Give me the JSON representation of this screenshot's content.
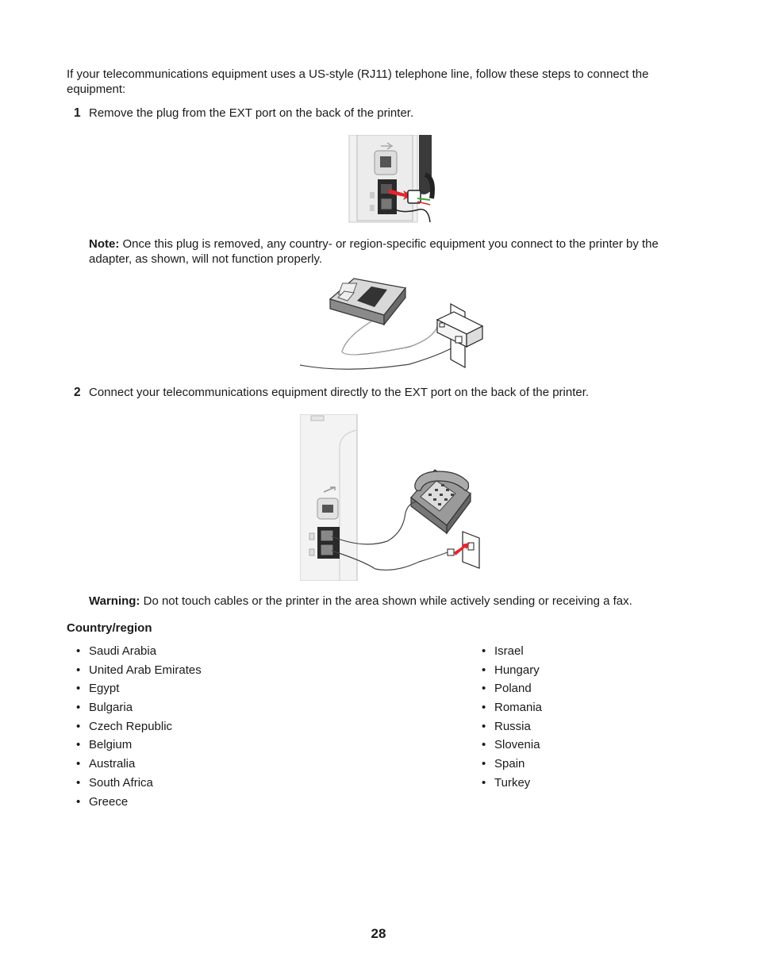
{
  "intro": "If your telecommunications equipment uses a US-style (RJ11) telephone line, follow these steps to connect the equipment:",
  "steps": [
    {
      "number": "1",
      "text": "Remove the plug from the EXT port on the back of the printer."
    },
    {
      "number": "2",
      "text": "Connect your telecommunications equipment directly to the EXT port on the back of the printer."
    }
  ],
  "note": {
    "label": "Note:",
    "text": " Once this plug is removed, any country- or region-specific equipment you connect to the printer by the adapter, as shown, will not function properly."
  },
  "warning": {
    "label": "Warning:",
    "text": " Do not touch cables or the printer in the area shown while actively sending or receiving a fax."
  },
  "figures": {
    "fig1": "remove-plug-from-ext-port-illustration",
    "fig2": "device-connected-via-adapter-illustration",
    "fig3": "telephone-connected-to-ext-port-illustration"
  },
  "countries": {
    "heading": "Country/region",
    "bullet": "•",
    "left": [
      "Saudi Arabia",
      "United Arab Emirates",
      "Egypt",
      "Bulgaria",
      "Czech Republic",
      "Belgium",
      "Australia",
      "South Africa",
      "Greece"
    ],
    "right": [
      "Israel",
      "Hungary",
      "Poland",
      "Romania",
      "Russia",
      "Slovenia",
      "Spain",
      "Turkey"
    ]
  },
  "page_number": "28",
  "colors": {
    "arrow_red": "#e2262b",
    "wire_green": "#3aa53f"
  }
}
